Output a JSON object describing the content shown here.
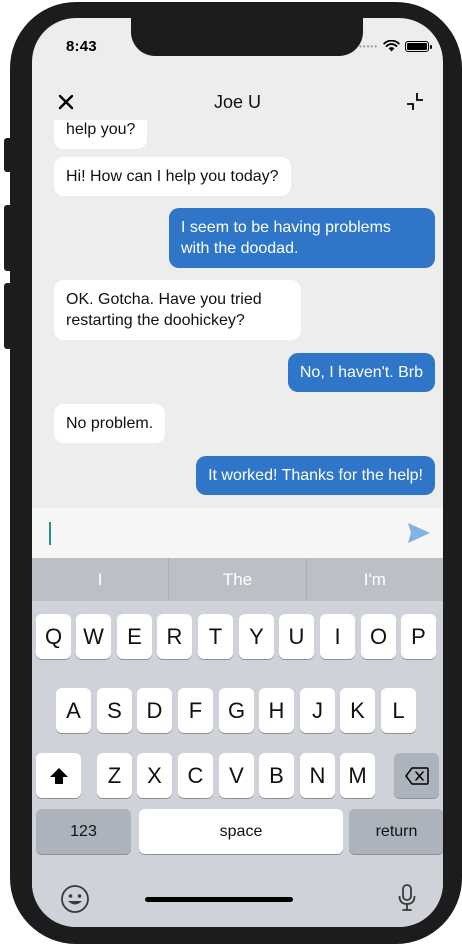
{
  "status": {
    "time": "8:43"
  },
  "nav": {
    "title": "Joe U"
  },
  "messages": [
    {
      "side": "incoming",
      "text": "help you?"
    },
    {
      "side": "incoming",
      "text": "Hi! How can I help you today?"
    },
    {
      "side": "outgoing",
      "text": "I seem to be having problems with the doodad."
    },
    {
      "side": "incoming",
      "text": "OK. Gotcha. Have you tried restarting the doohickey?"
    },
    {
      "side": "outgoing",
      "text": "No, I haven't. Brb"
    },
    {
      "side": "incoming",
      "text": "No problem."
    },
    {
      "side": "outgoing",
      "text": "It worked! Thanks for the help!"
    }
  ],
  "composer": {
    "value": ""
  },
  "keyboard": {
    "suggestions": [
      "I",
      "The",
      "I'm"
    ],
    "row1": [
      "Q",
      "W",
      "E",
      "R",
      "T",
      "Y",
      "U",
      "I",
      "O",
      "P"
    ],
    "row2": [
      "A",
      "S",
      "D",
      "F",
      "G",
      "H",
      "J",
      "K",
      "L"
    ],
    "row3": [
      "Z",
      "X",
      "C",
      "V",
      "B",
      "N",
      "M"
    ],
    "numbers_label": "123",
    "space_label": "space",
    "return_label": "return"
  },
  "colors": {
    "outgoing_bubble": "#2f76c9",
    "send_icon": "#7fb3e3",
    "cursor": "#2a8f86"
  },
  "icons": [
    "close-icon",
    "minimize-icon",
    "send-icon",
    "shift-icon",
    "backspace-icon",
    "emoji-icon",
    "microphone-icon",
    "wifi-icon",
    "battery-icon"
  ]
}
